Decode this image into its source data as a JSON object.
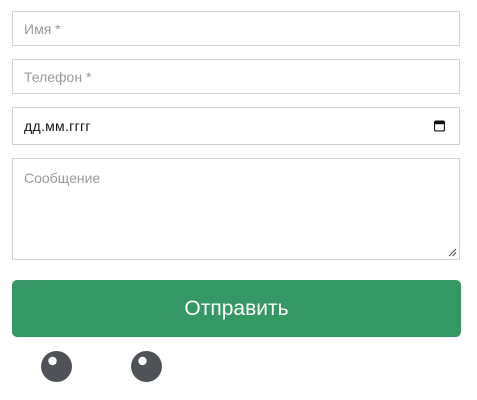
{
  "form": {
    "name_placeholder": "Имя *",
    "phone_placeholder": "Телефон *",
    "date_value": "дд.мм.гггг",
    "message_placeholder": "Сообщение",
    "submit_label": "Отправить"
  },
  "colors": {
    "accent": "#359764",
    "border": "#cfcfcf",
    "placeholder": "#9a9a9a",
    "dot": "#4f5257"
  }
}
